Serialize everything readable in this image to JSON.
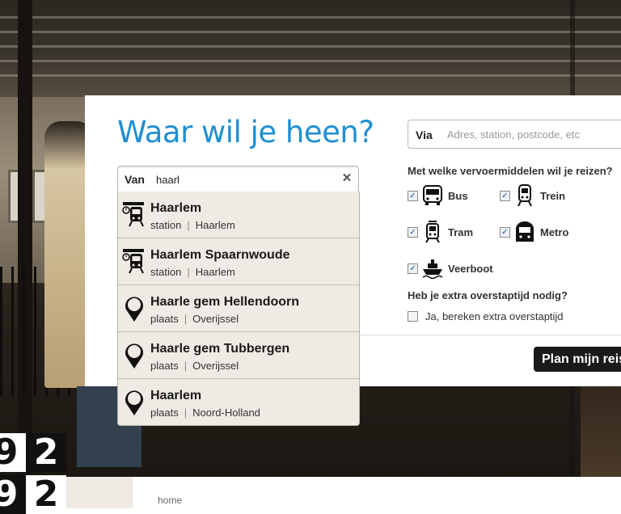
{
  "headline": "Waar wil je heen?",
  "from": {
    "label": "Van",
    "value": "haarl",
    "clear_icon": "close-icon"
  },
  "suggestions": [
    {
      "name": "Haarlem",
      "type": "station",
      "region": "Haarlem",
      "icon": "train-station-icon"
    },
    {
      "name": "Haarlem Spaarnwoude",
      "type": "station",
      "region": "Haarlem",
      "icon": "train-station-icon"
    },
    {
      "name": "Haarle gem Hellendoorn",
      "type": "plaats",
      "region": "Overijssel",
      "icon": "map-pin-icon"
    },
    {
      "name": "Haarle gem Tubbergen",
      "type": "plaats",
      "region": "Overijssel",
      "icon": "map-pin-icon"
    },
    {
      "name": "Haarlem",
      "type": "plaats",
      "region": "Noord-Holland",
      "icon": "map-pin-icon"
    }
  ],
  "via": {
    "label": "Via",
    "placeholder": "Adres, station, postcode, etc"
  },
  "transport": {
    "question": "Met welke vervoermiddelen wil je reizen?",
    "modes": [
      {
        "label": "Bus",
        "checked": true,
        "icon": "bus-icon"
      },
      {
        "label": "Trein",
        "checked": true,
        "icon": "train-icon"
      },
      {
        "label": "Tram",
        "checked": true,
        "icon": "tram-icon"
      },
      {
        "label": "Metro",
        "checked": true,
        "icon": "metro-icon"
      },
      {
        "label": "Veerboot",
        "checked": true,
        "icon": "ferry-icon"
      }
    ]
  },
  "transfer": {
    "question": "Heb je extra overstaptijd nodig?",
    "option_label": "Ja, bereken extra overstaptijd",
    "checked": false
  },
  "plan_button": "Plan mijn reis",
  "tiles": [
    {
      "digit": "9"
    },
    {
      "digit": "2"
    },
    {
      "digit": "9"
    },
    {
      "digit": "2"
    }
  ],
  "breadcrumb": "home",
  "colors": {
    "accent": "#1f8fd1",
    "dropdown_bg": "#efebe4",
    "button_bg": "#1a1a1a"
  }
}
